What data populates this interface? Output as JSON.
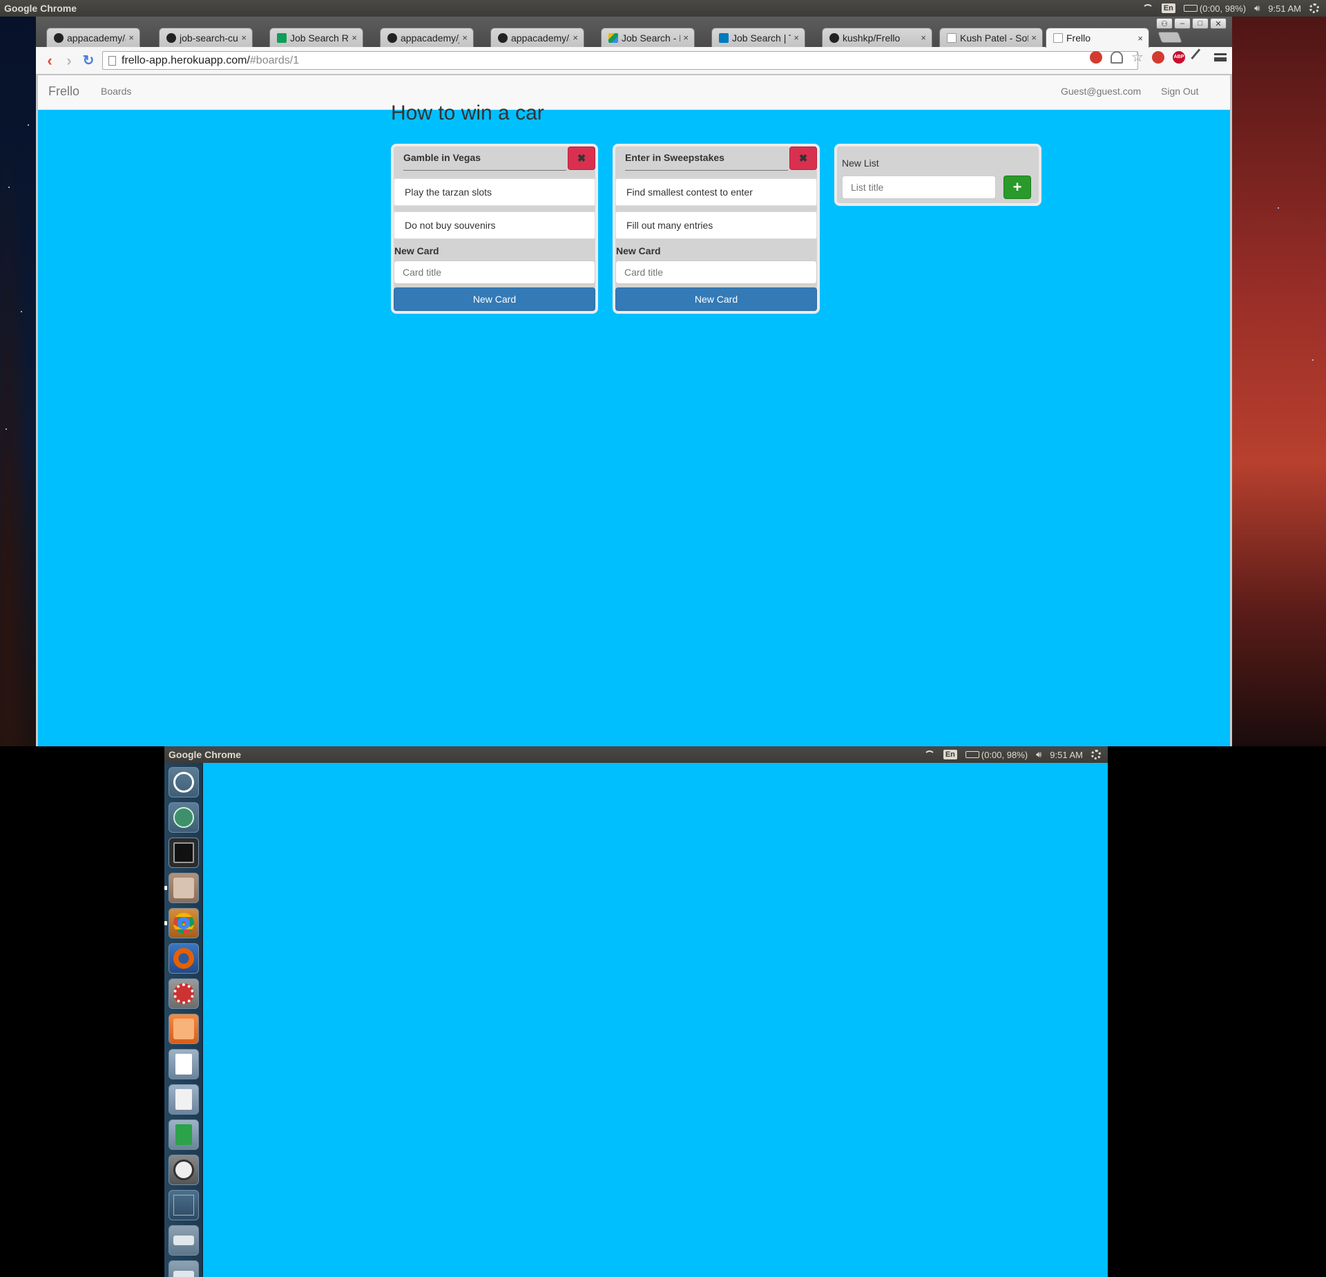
{
  "os": {
    "app_title": "Google Chrome",
    "keyboard": "En",
    "battery": "(0:00, 98%)",
    "clock": "9:51 AM"
  },
  "browser": {
    "tabs": [
      {
        "label": "appacademy/al",
        "icon": "github-icon"
      },
      {
        "label": "job-search-curr",
        "icon": "github-icon"
      },
      {
        "label": "Job Search Roa",
        "icon": "sheets-icon"
      },
      {
        "label": "appacademy/jo",
        "icon": "github-icon"
      },
      {
        "label": "appacademy/al",
        "icon": "github-icon"
      },
      {
        "label": "Job Search - Ku",
        "icon": "drive-icon"
      },
      {
        "label": "Job Search | Tre",
        "icon": "trello-icon"
      },
      {
        "label": "kushkp/Frello",
        "icon": "github-icon"
      },
      {
        "label": "Kush Patel - Sof",
        "icon": "document-icon"
      },
      {
        "label": "Frello",
        "icon": "document-icon",
        "active": true
      }
    ],
    "url_host": "frello-app.herokuapp.com/",
    "url_path": "#boards/1",
    "close_glyph": "×"
  },
  "app": {
    "brand": "Frello",
    "nav_boards": "Boards",
    "user_email": "Guest@guest.com",
    "sign_out": "Sign Out",
    "board_title": "How to win a car",
    "lists": [
      {
        "title": "Gamble in Vegas",
        "cards": [
          "Play the tarzan slots",
          "Do not buy souvenirs"
        ],
        "new_card_label": "New Card",
        "card_placeholder": "Card title",
        "new_card_button": "New Card"
      },
      {
        "title": "Enter in Sweepstakes",
        "cards": [
          "Find smallest contest to enter",
          "Fill out many entries"
        ],
        "new_card_label": "New Card",
        "card_placeholder": "Card title",
        "new_card_button": "New Card"
      }
    ],
    "new_list": {
      "label": "New List",
      "placeholder": "List title"
    },
    "colors": {
      "board_background": "#00bfff",
      "delete_button": "#d9304f",
      "new_card_button": "#337ab7",
      "add_list_button": "#2a9a2a"
    }
  },
  "launcher": {
    "apps": [
      "dash-icon",
      "atom-icon",
      "terminal-icon",
      "files-icon",
      "chrome-icon",
      "firefox-icon",
      "system-settings-icon",
      "software-center-icon",
      "writer-icon",
      "text-editor-icon",
      "calc-icon",
      "software-updater-icon",
      "workspaces-icon",
      "drive-icon",
      "trash-icon"
    ]
  }
}
